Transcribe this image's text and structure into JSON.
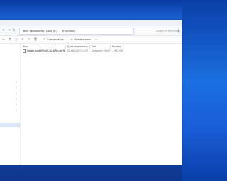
{
  "address": {
    "crumbs": [
      "Этот компьютер",
      "Data (E:)",
      "Кухтилин"
    ],
    "search_placeholder": "Поиск в: Кухтилин"
  },
  "toolbar": {
    "sort_label": "Сортировать",
    "view_label": "Просмотреть",
    "more_label": "···"
  },
  "columns": {
    "name": "Имя",
    "date": "Дата изменения",
    "type": "Тип",
    "size": "Размер"
  },
  "files": [
    {
      "name": "Labbe kuxtelPrc0C,b2,b7th.okr9b...",
      "date": "05.06.2024 14:57",
      "type": "Документ WinRAR",
      "size": "1 982 КБ"
    }
  ],
  "colors": {
    "desktop": "#1b6fe0",
    "selection": "#dbe7f6"
  }
}
